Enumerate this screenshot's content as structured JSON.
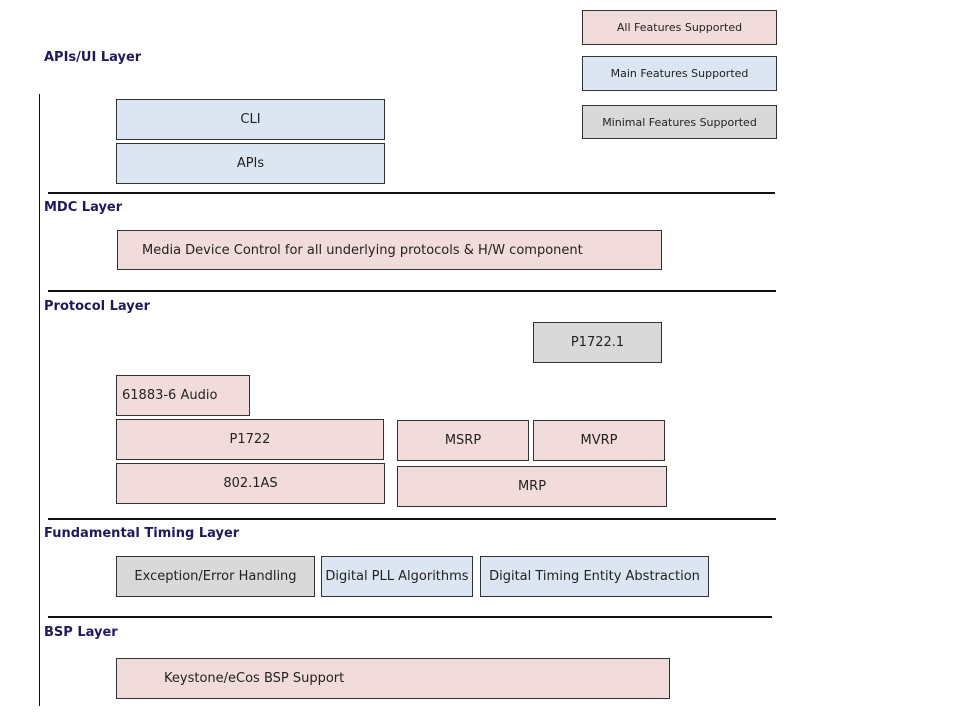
{
  "colors": {
    "all": "#f2dcdb",
    "main": "#dce6f2",
    "minimal": "#d9d9d9",
    "layer_title": "#1f1a5e"
  },
  "legend": {
    "all": "All Features Supported",
    "main": "Main Features Supported",
    "minimal": "Minimal Features Supported"
  },
  "layers": {
    "api": {
      "title": "APIs/UI Layer",
      "cli": "CLI",
      "apis": "APIs"
    },
    "mdc": {
      "title": "MDC Layer",
      "media": "Media Device Control for all underlying protocols & H/W component"
    },
    "protocol": {
      "title": "Protocol Layer",
      "p17221": "P1722.1",
      "audio": "61883-6 Audio",
      "p1722": "P1722",
      "as": "802.1AS",
      "msrp": "MSRP",
      "mvrp": "MVRP",
      "mrp": "MRP"
    },
    "timing": {
      "title": "Fundamental Timing Layer",
      "exception": "Exception/Error Handling",
      "pll": "Digital PLL Algorithms",
      "dtea": "Digital Timing Entity Abstraction"
    },
    "bsp": {
      "title": "BSP Layer",
      "keystone": "Keystone/eCos BSP Support"
    }
  }
}
